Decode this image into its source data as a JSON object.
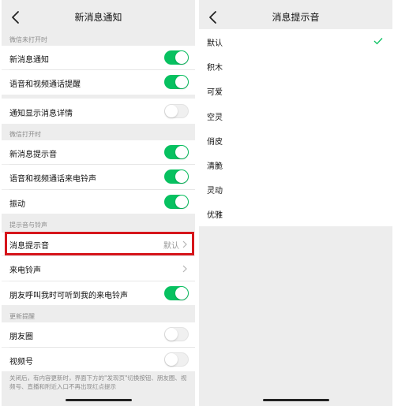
{
  "left": {
    "title": "新消息通知",
    "sections": {
      "wechat_closed": "微信未打开时",
      "wechat_open": "微信打开时",
      "sound": "提示音与铃声",
      "updates": "更新提醒"
    },
    "rows": {
      "new_msg_notify": "新消息通知",
      "voice_video_remind": "语音和视频通话提醒",
      "show_detail": "通知显示消息详情",
      "new_msg_sound": "新消息提示音",
      "voice_video_ringtone": "语音和视频通话来电铃声",
      "vibrate": "振动",
      "msg_sound": "消息提示音",
      "msg_sound_value": "默认",
      "ringtone": "来电铃声",
      "friend_ringtone": "朋友呼叫我时可听到我的来电铃声",
      "moments": "朋友圈",
      "channels": "视频号"
    },
    "toggles": {
      "new_msg_notify": true,
      "voice_video_remind": true,
      "show_detail": false,
      "new_msg_sound": true,
      "voice_video_ringtone": true,
      "vibrate": true,
      "friend_ringtone": true,
      "moments": false,
      "channels": false
    },
    "footnote": "关闭后，有内容更新时，界面下方的\"发现页\"切换按钮、朋友圈、视频号、直播和附近入口不再出现红点提示"
  },
  "right": {
    "title": "消息提示音",
    "options": [
      "默认",
      "积木",
      "可爱",
      "空灵",
      "俏皮",
      "清脆",
      "灵动",
      "优雅"
    ],
    "selected_index": 0
  },
  "colors": {
    "accent": "#07c160",
    "highlight": "#d6151b",
    "background": "#ededed"
  }
}
